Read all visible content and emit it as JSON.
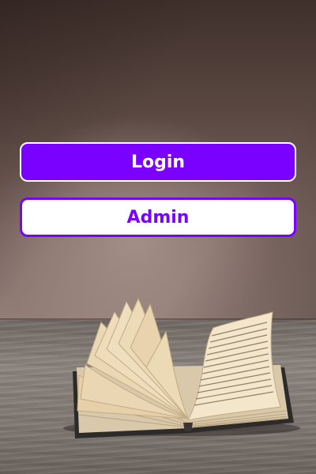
{
  "buttons": {
    "login_label": "Login",
    "admin_label": "Admin"
  },
  "background": {
    "image": "open-book-on-wooden-table"
  },
  "colors": {
    "accent": "#7a00ff",
    "button_text_light": "#ffffff"
  }
}
